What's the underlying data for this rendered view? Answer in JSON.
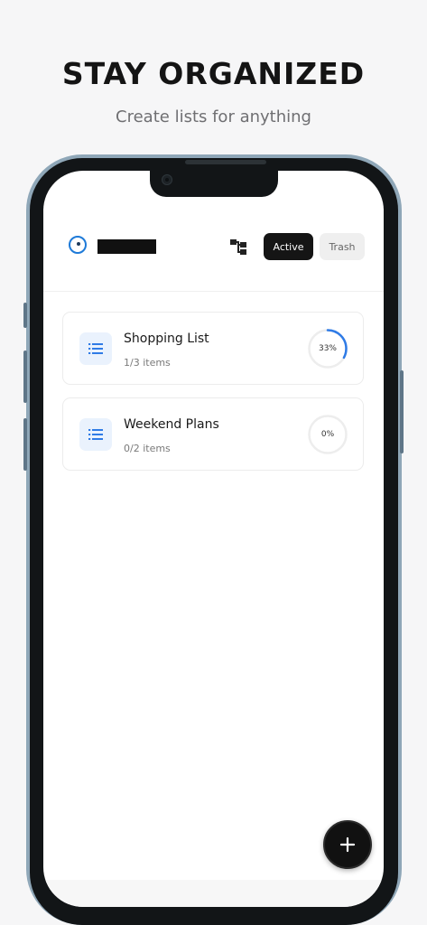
{
  "promo": {
    "headline": "STAY ORGANIZED",
    "subline": "Create lists for anything"
  },
  "header": {
    "active_label": "Active",
    "trash_label": "Trash",
    "logo_icon": "circle-dot-icon",
    "view_icon": "tree-structure-icon"
  },
  "lists": [
    {
      "title": "Shopping List",
      "subtitle": "1/3 items",
      "progress": 0.33,
      "progress_label": "33%"
    },
    {
      "title": "Weekend Plans",
      "subtitle": "0/2 items",
      "progress": 0,
      "progress_label": "0%"
    }
  ],
  "fab": {
    "icon": "plus-icon"
  },
  "colors": {
    "accent": "#2f7be6",
    "card_icon_bg": "#eaf2fd",
    "active_bg": "#151515",
    "trash_bg": "#efefef",
    "frame": "#8fa7b8"
  }
}
